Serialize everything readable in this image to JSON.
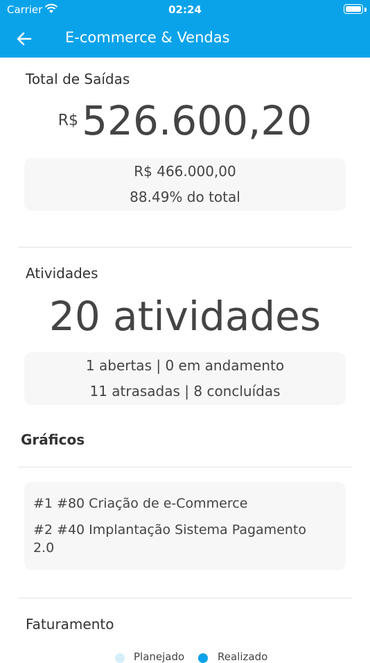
{
  "status_bar": {
    "carrier": "Carrier",
    "time": "02:24"
  },
  "nav": {
    "title": "E-commerce & Vendas"
  },
  "saidas": {
    "title": "Total de Saídas",
    "currency": "R$",
    "total": "526.600,20",
    "realizado": "R$  466.000,00",
    "percent": "88.49% do total"
  },
  "atividades": {
    "title": "Atividades",
    "count": "20 atividades",
    "line1": "1 abertas | 0 em andamento",
    "line2": "11 atrasadas | 8 concluídas"
  },
  "graficos": {
    "title": "Gráficos",
    "items": [
      {
        "label": "#1 #80 Criação de e-Commerce"
      },
      {
        "label": "#2 #40 Implantação Sistema Pagamento 2.0"
      }
    ]
  },
  "faturamento": {
    "title": "Faturamento",
    "legend": [
      {
        "label": "Planejado",
        "color": "#d6eefa"
      },
      {
        "label": "Realizado",
        "color": "#0aa3ea"
      }
    ]
  }
}
